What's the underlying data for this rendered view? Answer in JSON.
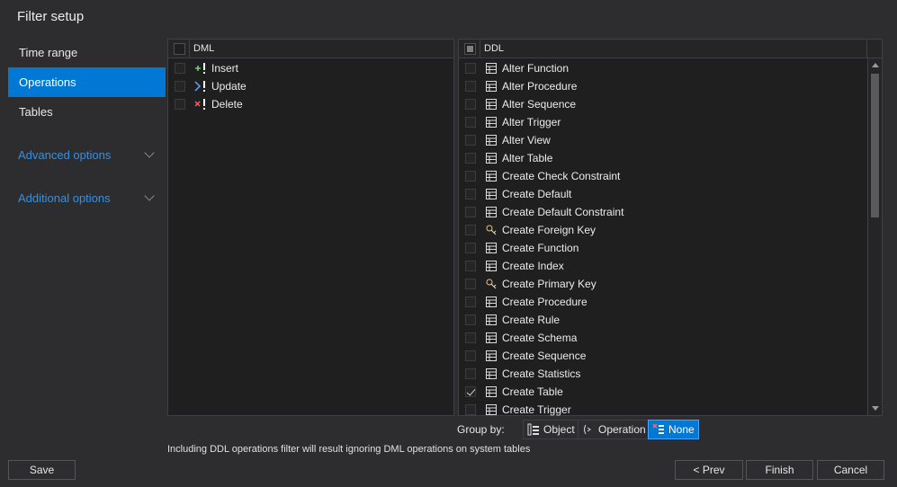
{
  "window": {
    "title": "Filter setup"
  },
  "nav": {
    "items": [
      {
        "label": "Time range"
      },
      {
        "label": "Operations"
      },
      {
        "label": "Tables"
      }
    ],
    "sections": [
      {
        "label": "Advanced options"
      },
      {
        "label": "Additional options"
      }
    ]
  },
  "dml": {
    "header": "DML",
    "rows": [
      {
        "label": "Insert",
        "icon": "insert-icon",
        "checked": false
      },
      {
        "label": "Update",
        "icon": "update-icon",
        "checked": false
      },
      {
        "label": "Delete",
        "icon": "delete-icon",
        "checked": false
      }
    ]
  },
  "ddl": {
    "header": "DDL",
    "rows": [
      {
        "label": "Alter Function",
        "icon": "function-icon",
        "checked": false
      },
      {
        "label": "Alter Procedure",
        "icon": "procedure-icon",
        "checked": false
      },
      {
        "label": "Alter Sequence",
        "icon": "sequence-icon",
        "checked": false
      },
      {
        "label": "Alter Trigger",
        "icon": "trigger-icon",
        "checked": false
      },
      {
        "label": "Alter View",
        "icon": "view-icon",
        "checked": false
      },
      {
        "label": "Alter Table",
        "icon": "table-icon",
        "checked": false
      },
      {
        "label": "Create Check Constraint",
        "icon": "check-constraint-icon",
        "checked": false
      },
      {
        "label": "Create Default",
        "icon": "default-icon",
        "checked": false
      },
      {
        "label": "Create Default Constraint",
        "icon": "default-constraint-icon",
        "checked": false
      },
      {
        "label": "Create Foreign Key",
        "icon": "foreign-key-icon",
        "checked": false
      },
      {
        "label": "Create Function",
        "icon": "function-icon",
        "checked": false
      },
      {
        "label": "Create Index",
        "icon": "index-icon",
        "checked": false
      },
      {
        "label": "Create Primary Key",
        "icon": "primary-key-icon",
        "checked": false
      },
      {
        "label": "Create Procedure",
        "icon": "procedure-icon",
        "checked": false
      },
      {
        "label": "Create Rule",
        "icon": "rule-icon",
        "checked": false
      },
      {
        "label": "Create Schema",
        "icon": "schema-icon",
        "checked": false
      },
      {
        "label": "Create Sequence",
        "icon": "sequence-icon",
        "checked": false
      },
      {
        "label": "Create Statistics",
        "icon": "statistics-icon",
        "checked": false
      },
      {
        "label": "Create Table",
        "icon": "table-icon",
        "checked": true
      },
      {
        "label": "Create Trigger",
        "icon": "trigger-icon",
        "checked": false
      }
    ]
  },
  "groupby": {
    "label": "Group by:",
    "options": [
      {
        "label": "Object",
        "icon": "object-group-icon"
      },
      {
        "label": "Operation",
        "icon": "operation-group-icon"
      },
      {
        "label": "None",
        "icon": "none-group-icon"
      }
    ],
    "selected": "None"
  },
  "note": "Including DDL operations filter will result ignoring DML operations on system tables",
  "buttons": {
    "save": "Save",
    "prev": "< Prev",
    "finish": "Finish",
    "cancel": "Cancel"
  },
  "colors": {
    "accent": "#0078d4",
    "link": "#3b8fd9",
    "background": "#2d2d30"
  }
}
